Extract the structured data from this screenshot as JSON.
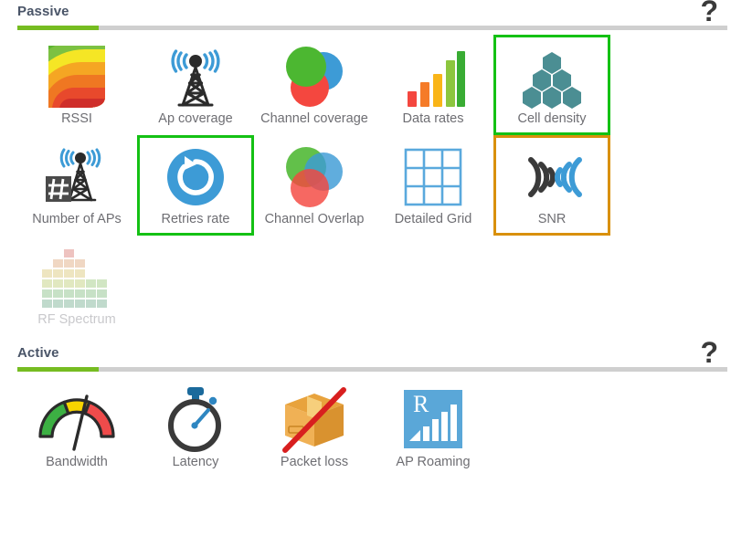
{
  "sections": [
    {
      "title": "Passive",
      "help_label": "?",
      "progress_fill_color": "#76bc21",
      "progress_track_color": "#cfcfcf",
      "rows": [
        [
          {
            "label": "RSSI",
            "icon": "rssi-heatmap-icon",
            "selection": "none",
            "enabled": true
          },
          {
            "label": "Ap coverage",
            "icon": "ap-tower-icon",
            "selection": "none",
            "enabled": true
          },
          {
            "label": "Channel coverage",
            "icon": "three-circles-icon",
            "selection": "none",
            "enabled": true
          },
          {
            "label": "Data rates",
            "icon": "bar-chart-icon",
            "selection": "none",
            "enabled": true
          },
          {
            "label": "Cell density",
            "icon": "hexagons-icon",
            "selection": "green",
            "enabled": true
          }
        ],
        [
          {
            "label": "Number of APs",
            "icon": "tower-hash-icon",
            "selection": "none",
            "enabled": true
          },
          {
            "label": "Retries rate",
            "icon": "refresh-circle-icon",
            "selection": "green",
            "enabled": true
          },
          {
            "label": "Channel Overlap",
            "icon": "venn-circles-icon",
            "selection": "none",
            "enabled": true
          },
          {
            "label": "Detailed Grid",
            "icon": "grid-3x3-icon",
            "selection": "none",
            "enabled": true
          },
          {
            "label": "SNR",
            "icon": "snr-waves-icon",
            "selection": "orange",
            "enabled": true
          }
        ],
        [
          {
            "label": "RF Spectrum",
            "icon": "spectrum-blocks-icon",
            "selection": "none",
            "enabled": false
          }
        ]
      ]
    },
    {
      "title": "Active",
      "help_label": "?",
      "progress_fill_color": "#76bc21",
      "progress_track_color": "#cfcfcf",
      "rows": [
        [
          {
            "label": "Bandwidth",
            "icon": "gauge-icon",
            "selection": "none",
            "enabled": true
          },
          {
            "label": "Latency",
            "icon": "stopwatch-icon",
            "selection": "none",
            "enabled": true
          },
          {
            "label": "Packet loss",
            "icon": "box-crossed-icon",
            "selection": "none",
            "enabled": true
          },
          {
            "label": "AP Roaming",
            "icon": "roaming-bars-icon",
            "selection": "none",
            "enabled": true
          }
        ]
      ]
    }
  ],
  "colors": {
    "selection_green": "#14c114",
    "selection_orange": "#d9900d",
    "label_text": "#6e6e73",
    "label_disabled": "#c9c9cc",
    "title_text": "#4a5568",
    "accent_green": "#76bc21",
    "teal": "#4b8e93",
    "blue": "#3d9bd6"
  }
}
